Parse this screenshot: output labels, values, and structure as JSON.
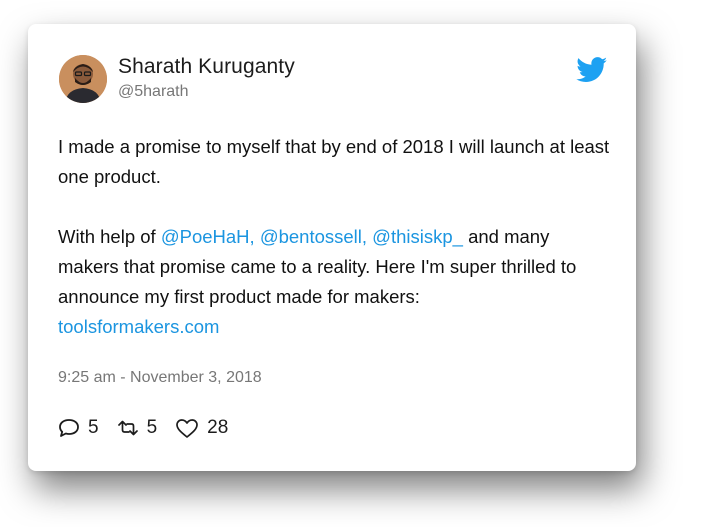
{
  "tweet": {
    "author": {
      "name": "Sharath Kuruganty",
      "handle": "@5harath",
      "avatar_icon": "user-avatar-photo"
    },
    "platform_icon": "twitter-bird-icon",
    "brand_color": "#1b95e0",
    "text": {
      "p1": "I made a promise to myself that by end of 2018 I will launch at least one product.",
      "p2_prefix": "With help of ",
      "mentions": "@PoeHaH, @bentossell, @thisiskp_",
      "p2_suffix": " and many makers that promise came to a reality. Here I'm super thrilled to announce my first product made for makers:",
      "link": "toolsformakers.com"
    },
    "timestamp": "9:25 am - November 3, 2018",
    "stats": {
      "replies": "5",
      "retweets": "5",
      "likes": "28"
    }
  }
}
